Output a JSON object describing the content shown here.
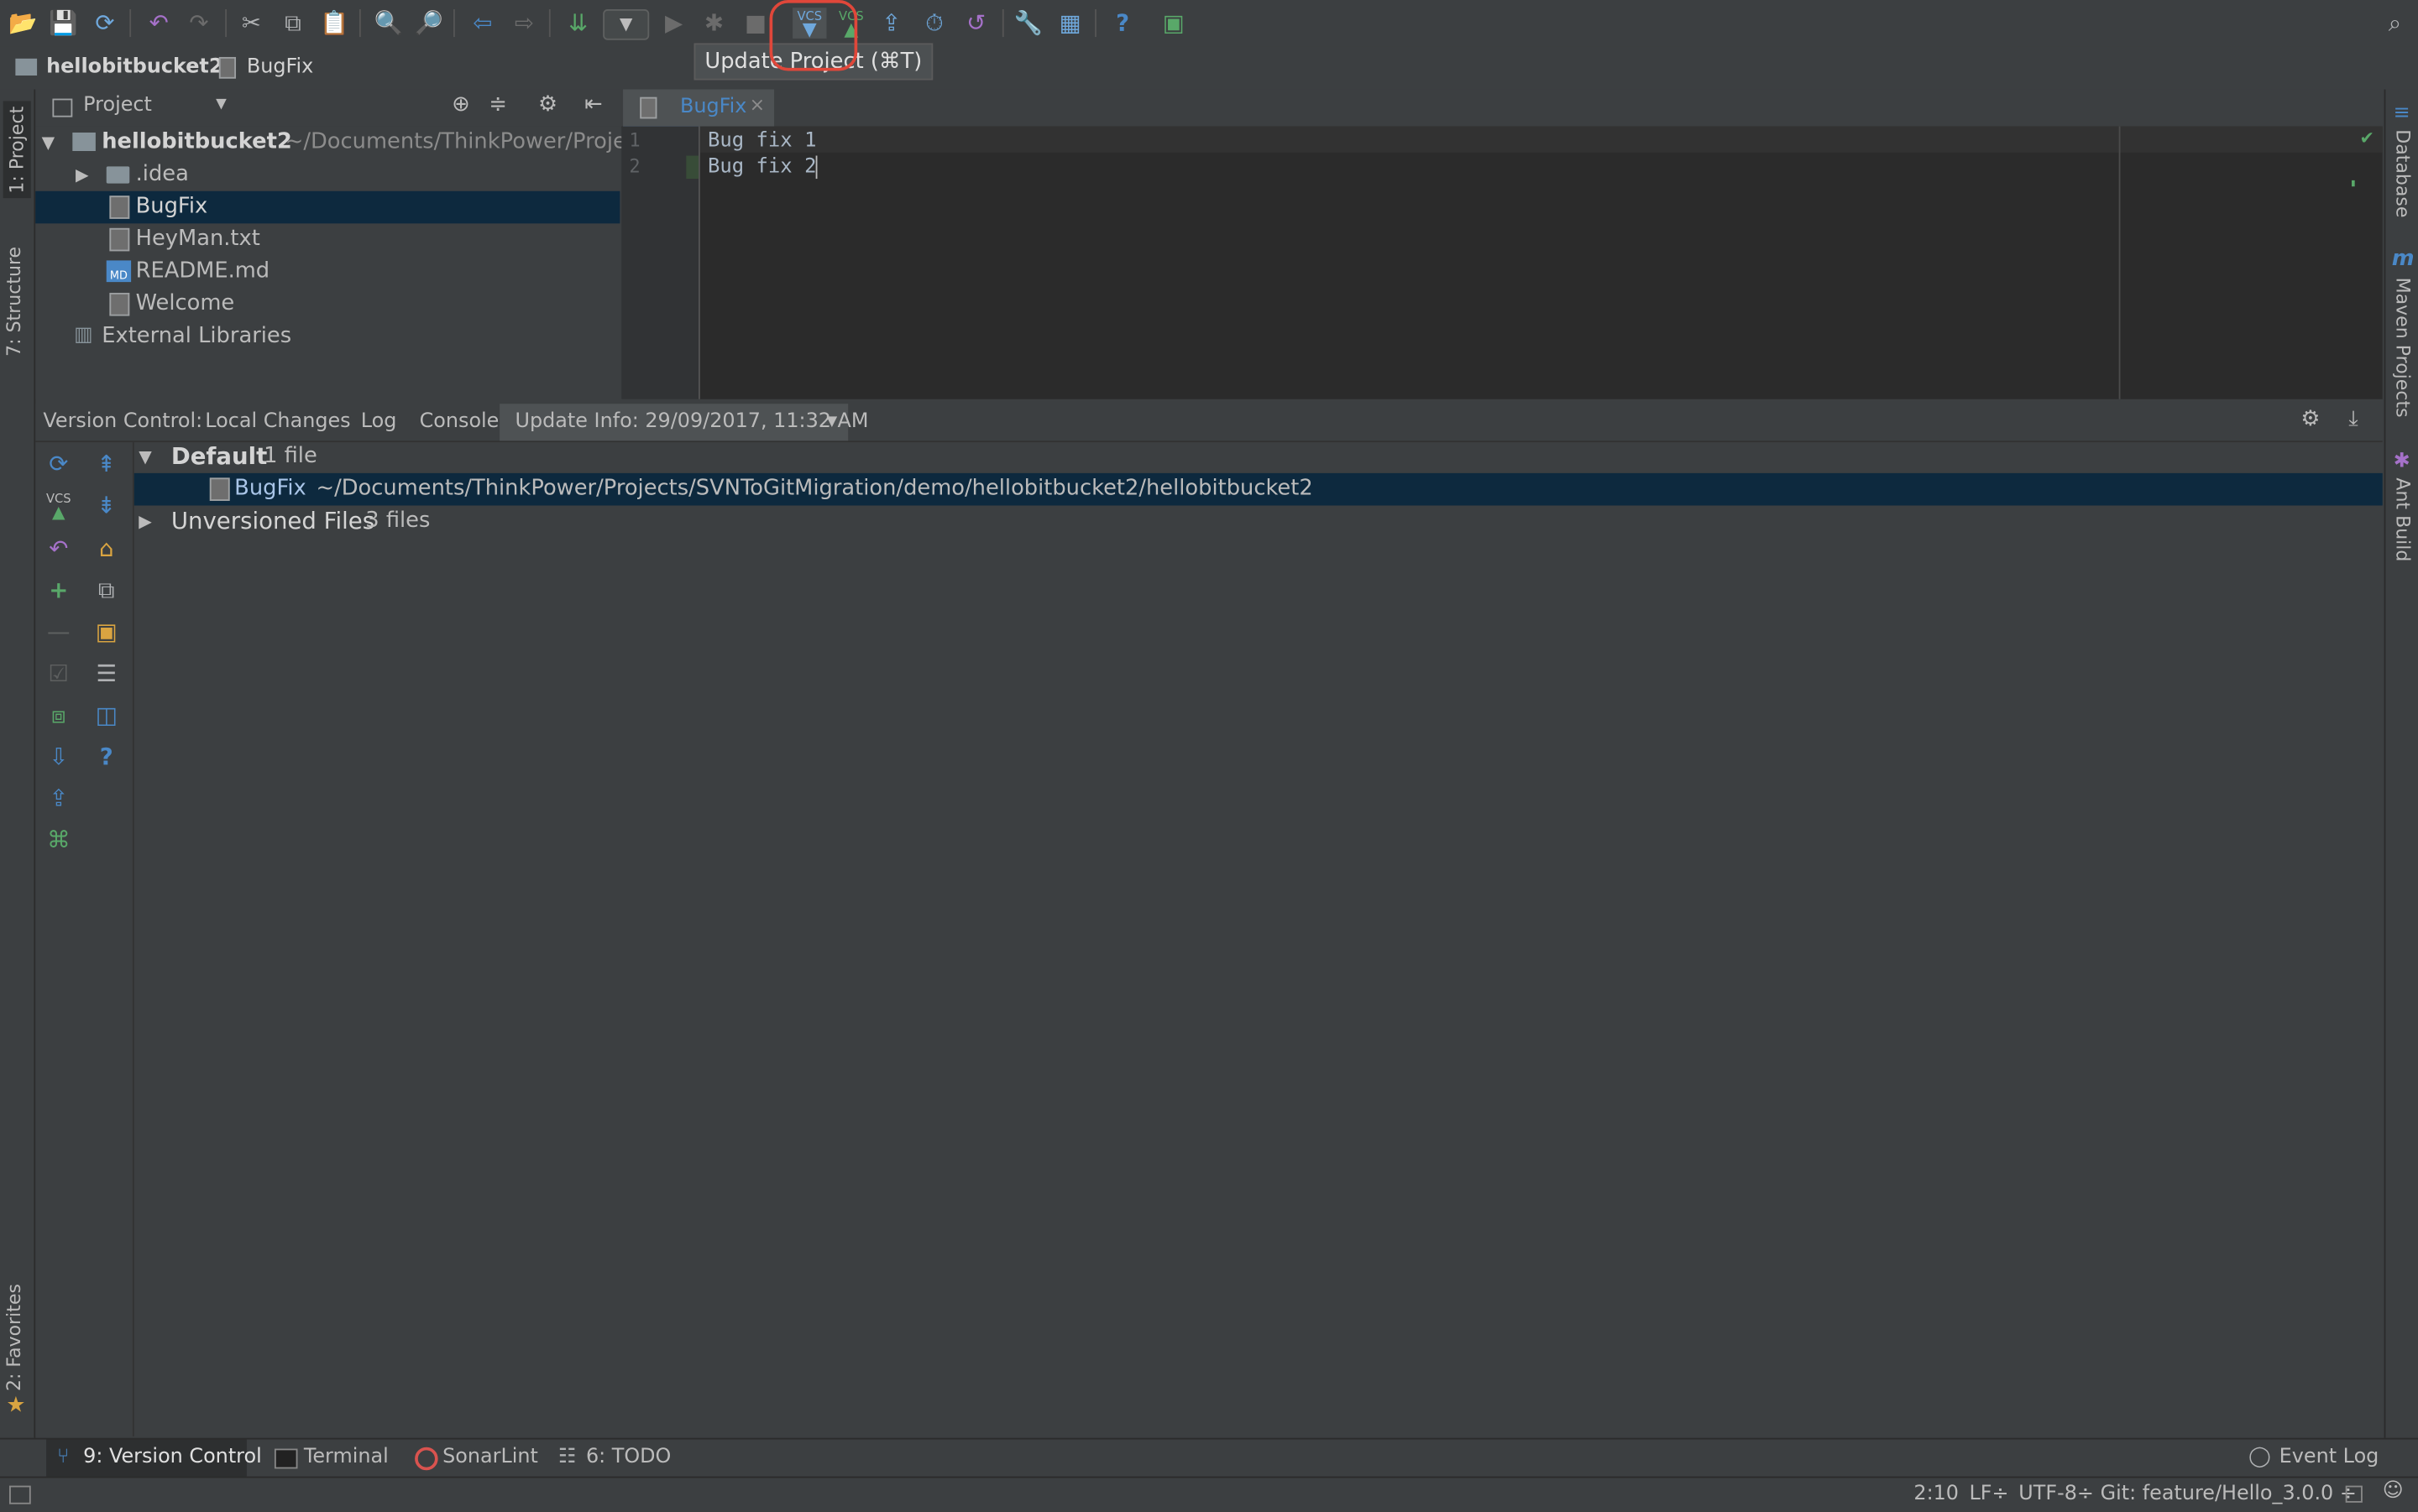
{
  "toolbar": {
    "icons": [
      "open-icon",
      "save-icon",
      "sync-icon",
      "undo-icon",
      "redo-icon",
      "cut-icon",
      "copy-icon",
      "paste-icon",
      "find-icon",
      "replace-icon",
      "back-icon",
      "forward-icon",
      "build-icon",
      "run-config-dropdown",
      "run-icon",
      "debug-icon",
      "stop-icon",
      "vcs-update-icon",
      "vcs-commit-icon",
      "vcs-push-icon",
      "vcs-history-icon",
      "vcs-revert-icon",
      "settings-icon",
      "project-structure-icon",
      "help-icon",
      "sdk-icon",
      "search-everywhere-icon"
    ],
    "tooltip": "Update Project (⌘T)"
  },
  "breadcrumb": {
    "project": "hellobitbucket2",
    "file": "BugFix"
  },
  "left_stripe": {
    "project_tab": "1: Project",
    "structure_tab": "7: Structure",
    "favorites_tab": "2: Favorites"
  },
  "right_stripe": {
    "database_tab": "Database",
    "maven_tab": "Maven Projects",
    "ant_tab": "Ant Build",
    "maven_glyph": "m"
  },
  "project_panel": {
    "title": "Project",
    "root_name": "hellobitbucket2",
    "root_path": "~/Documents/ThinkPower/Projec",
    "items": [
      {
        "label": ".idea"
      },
      {
        "label": "BugFix"
      },
      {
        "label": "HeyMan.txt"
      },
      {
        "label": "README.md"
      },
      {
        "label": "Welcome"
      }
    ],
    "external": "External Libraries",
    "md_badge": "MD"
  },
  "editor": {
    "tab_label": "BugFix",
    "line_numbers": [
      "1",
      "2"
    ],
    "lines": [
      "Bug fix 1",
      "Bug fix 2"
    ]
  },
  "vc_panel": {
    "label": "Version Control:",
    "tabs": [
      "Local Changes",
      "Log",
      "Console",
      "Update Info: 29/09/2017, 11:32 AM"
    ],
    "default_group": "Default",
    "default_count": "1 file",
    "file_name": "BugFix",
    "file_path": "~/Documents/ThinkPower/Projects/SVNToGitMigration/demo/hellobitbucket2/hellobitbucket2",
    "unversioned": "Unversioned Files",
    "unversioned_count": "3 files",
    "vcs_glyph": "VCS"
  },
  "bottom_tools": {
    "version_control": "9: Version Control",
    "terminal": "Terminal",
    "sonarlint": "SonarLint",
    "todo": "6: TODO",
    "event_log": "Event Log"
  },
  "status": {
    "position": "2:10",
    "line_sep": "LF÷",
    "encoding": "UTF-8÷",
    "git_branch": "Git: feature/Hello_3.0.0 ÷"
  },
  "colors": {
    "accent": "#4a88c7",
    "selection": "#0d293e",
    "highlight": "#e0473a"
  }
}
